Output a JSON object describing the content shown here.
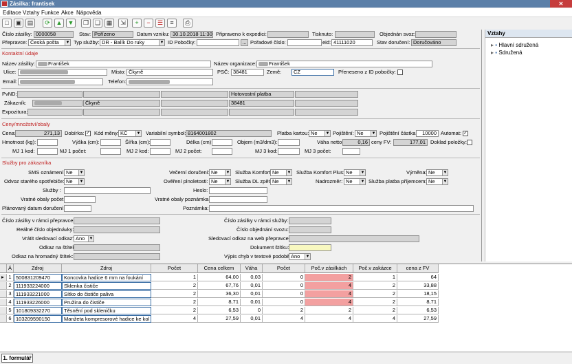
{
  "window": {
    "title": "Zásilka: frantisek"
  },
  "menu": [
    "Editace",
    "Vztahy",
    "Funkce",
    "Akce",
    "Nápověda"
  ],
  "toolbar_icons": [
    "new-icon",
    "save-icon",
    "save-as-icon",
    "refresh-icon",
    "arrow-up-icon",
    "arrow-down-icon",
    "copy-icon",
    "copy-doc-icon",
    "paste-icon",
    "export-icon",
    "add-icon",
    "remove-icon",
    "remove-list-icon",
    "list-icon",
    "print-icon"
  ],
  "header": {
    "cislo_label": "Číslo zásilky:",
    "cislo": "0000058",
    "stav_label": "Stav:",
    "stav": "Pořízeno",
    "datum_label": "Datum vzniku:",
    "datum": "30.10.2018 11:30",
    "pripraveno_label": "Připraveno k expedici:",
    "tisknuto_label": "Tisknuto:",
    "objednan_label": "Objednán svoz:"
  },
  "row2": {
    "prepravce_label": "Přepravce:",
    "prepravce": "Česká pošta",
    "typ_label": "Typ služby:",
    "typ": "DR - Balík Do ruky",
    "idpob_label": "ID Pobočky:",
    "browse": "...",
    "poradove_label": "Pořadové číslo:",
    "eid_label": "eid:",
    "eid": "41111020",
    "stav_doruceni_label": "Stav doručení:",
    "stav_doruceni": "Doručováno"
  },
  "kontakt": {
    "section": "Kontaktní údaje",
    "nazev_zas_label": "Název zásilky:",
    "nazev_zas": "František",
    "nazev_org_label": "Název organizace:",
    "nazev_org": "František",
    "ulice_label": "Ulice:",
    "misto_label": "Místo:",
    "misto": "Čkyně",
    "psc_label": "PSČ:",
    "psc": "38481",
    "zeme_label": "Země:",
    "zeme": "CZ",
    "preneseno_label": "Přeneseno z ID pobočky:",
    "email_label": "Email:",
    "telefon_label": "Telefon:"
  },
  "pvnd": {
    "pvnd_label": "PvND:",
    "hotovost": "Hotovostní platba",
    "zakaznik_label": "Zákazník:",
    "zak_misto": "Čkyně",
    "zak_psc": "38481",
    "expozitura_label": "Expozitura:"
  },
  "ceny": {
    "section": "Ceny/množství/obaly",
    "cena_label": "Cena:",
    "cena": "271,13",
    "dobirka_label": "Dobírka:",
    "kod_meny_label": "Kód měny:",
    "kod_meny": "KČ",
    "var_sym_label": "Variabilní symbol:",
    "var_sym": "8164001802",
    "platba_kartou_label": "Platba kartou:",
    "platba_kartou": "Ne",
    "pojisteni_label": "Pojištění:",
    "pojisteni": "Ne",
    "poj_castka_label": "Pojištění částka:",
    "poj_castka": "10000",
    "automat_label": "Automat:",
    "hmotnost_label": "Hmotnost (kg):",
    "vyska_label": "Výška (cm):",
    "sirka_label": "Šířka (cm):",
    "delka_label": "Délka (cm):",
    "objem_label": "Objem (m3/dm3):",
    "vaha_netto_label": "Váha netto:",
    "vaha_netto": "0,16",
    "cena_fv_label": "ceny FV:",
    "cena_fv": "177,01",
    "doklad_label": "Doklad položky:",
    "mj1kod_label": "MJ 1 kod:",
    "mj1poc_label": "MJ 1 počet:",
    "mj2kod_label": "MJ 2 kod:",
    "mj2poc_label": "MJ 2 počet:",
    "mj3kod_label": "MJ 3 kod:",
    "mj3poc_label": "MJ 3 počet:"
  },
  "sluzby": {
    "section": "Služby pro zákazníka",
    "sms_label": "SMS oznámení:",
    "sms": "Ne",
    "vecerni_label": "Večerní doručení:",
    "vecerni": "Ne",
    "komfort_label": "Služba Komfort:",
    "komfort": "Ne",
    "komfort_plus_label": "Služba Komfort Plus:",
    "komfort_plus": "Ne",
    "vymena_label": "Výměna:",
    "vymena": "Ne",
    "odvoz_label": "Odvoz starého spotřebiče:",
    "odvoz": "Ne",
    "overeni_label": "Ověření plnoletosti:",
    "overeni": "Ne",
    "dl_zpet_label": "Služba DL zpět:",
    "dl_zpet": "Ne",
    "nadrozmer_label": "Nadrozměr:",
    "nadrozmer": "Ne",
    "platba_prij_label": "Služba platba příjemcem:",
    "platba_prij": "Ne",
    "sluzby_label": "Služby :",
    "heslo_label": "Heslo:",
    "vratne_pocet_label": "Vratné obaly počet:",
    "vratne_pozn_label": "Vratné obaly poznámka:",
    "planovany_label": "Plánovaný datum doručení:",
    "poznamka_label": "Poznámka:"
  },
  "dalsi": {
    "cislo_prepr_label": "Číslo zásilky v rámci přepravce:",
    "cislo_sluzby_label": "Číslo zásilky v rámci služby:",
    "realne_label": "Reálné číslo objednávky:",
    "cislo_svozu_label": "Číslo objednání svozu:",
    "vratit_label": "Vrátit sledovací odkaz?:",
    "vratit": "Ano",
    "sled_web_label": "Sledovací odkaz na web přepravce:",
    "odkaz_stitek_label": "Odkaz na štítek:",
    "dokument_label": "Dokument štítku:",
    "odkaz_hrom_label": "Odkaz na hromadný štítek:",
    "vypis_label": "Výpis chyb v textové podobě:",
    "vypis": "Ano"
  },
  "side": {
    "title": "Vztahy",
    "items": [
      "Hlavní sdružená",
      "Sdružená"
    ]
  },
  "grid": {
    "headers": [
      "",
      "Á",
      "Zdroj",
      "Zdroj",
      "Počet",
      "Cena celkem",
      "Váha",
      "Počet",
      "Poč.v zásilkách",
      "Poč.v zakázce",
      "cena z FV"
    ],
    "rows": [
      [
        "1",
        "500831209470",
        "Koncovka hadice 6 mm na foukání",
        "1",
        "64,00",
        "0,03",
        "0",
        "2",
        "1",
        "64"
      ],
      [
        "2",
        "111933224000",
        "Sklenka čističe",
        "2",
        "67,76",
        "0,01",
        "0",
        "4",
        "2",
        "33,88"
      ],
      [
        "3",
        "111933221000",
        "Sítko do čističe paliva",
        "2",
        "36,30",
        "0,01",
        "0",
        "4",
        "2",
        "18,15"
      ],
      [
        "4",
        "111933226000",
        "Pružina do čističe",
        "2",
        "8,71",
        "0,01",
        "0",
        "4",
        "2",
        "8,71"
      ],
      [
        "5",
        "101809332270",
        "Těsnění pod skleničku",
        "2",
        "6,53",
        "0",
        "2",
        "2",
        "2",
        "6,53"
      ],
      [
        "6",
        "103209590150",
        "Manžeta kompresorové hadice ke kol",
        "4",
        "27,59",
        "0,01",
        "4",
        "4",
        "4",
        "27,59"
      ]
    ]
  },
  "status": {
    "tab": "1. formulář"
  }
}
